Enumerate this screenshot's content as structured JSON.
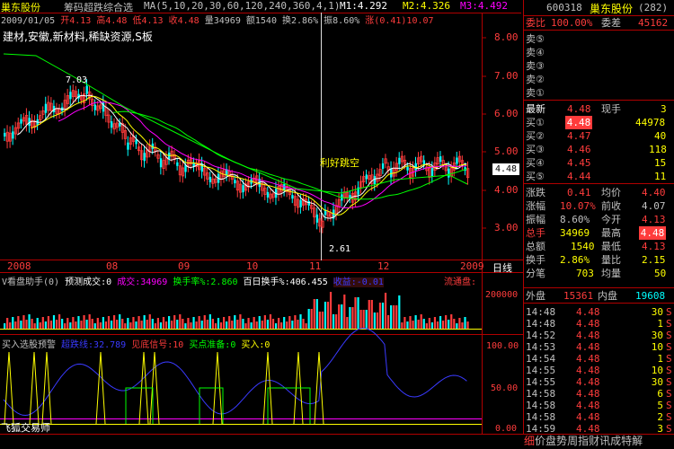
{
  "colors": {
    "up": "#ff3c3c",
    "down": "#00ffff",
    "flat": "#ffffff",
    "yellow": "#ffff00",
    "green": "#00ff00",
    "magenta": "#ff00ff",
    "blue": "#3a3aff",
    "axis": "#b00000"
  },
  "header": {
    "stock_name": "巢东股份",
    "indicator": "筹码超跌综合选",
    "ma_label": "MA(5,10,20,30,60,120,240,360,4,1)",
    "m1": "M1:4.292",
    "m2": "M2:4.326",
    "m3": "M3:4.492"
  },
  "info_line": {
    "date": "2009/01/05",
    "open_label": "开",
    "open": "4.13",
    "high_label": "高",
    "high": "4.48",
    "low_label": "低",
    "low": "4.13",
    "close_label": "收",
    "close": "4.48",
    "vol_label": "量",
    "vol": "34969",
    "amt_label": "额",
    "amt": "1540",
    "turnover_label": "换",
    "turnover": "2.86%",
    "amp_label": "振",
    "amp": "8.60%",
    "rise_label": "涨",
    "rise": "(0.41)10.07"
  },
  "sectors": "建材,安徽,新材料,稀缺资源,S板",
  "price_chart": {
    "y_ticks": [
      "8.00",
      "7.00",
      "6.00",
      "5.00",
      "4.00",
      "3.00"
    ],
    "max_label": "7.03",
    "min_label": "2.61",
    "event_label": "利好跳空",
    "current_price": "4.48"
  },
  "x_axis": {
    "labels": [
      "2008",
      "08",
      "09",
      "10",
      "11",
      "12",
      "2009"
    ],
    "period": "日线"
  },
  "volume_panel": {
    "title": "V看盘助手(0)",
    "deal_label": "预测成交:0",
    "vol_text": "成交:34969",
    "turn_text": "换手率%:2.860",
    "hundred_text": "百日换手%:406.455",
    "pan_text": "收益:-0.01",
    "circ_text": "流通盘:",
    "y_tick": "200000"
  },
  "signal_panel": {
    "title": "买入选股预警",
    "super": "超跌线:32.789",
    "signal": "见底信号:10",
    "ready": "买点准备:0",
    "buy": "买入:0",
    "y_ticks": [
      "100.00",
      "50.00",
      "0.00"
    ],
    "author": "飞狐交易师"
  },
  "quote": {
    "code": "600318",
    "name": "巢东股份",
    "count": "(282)",
    "wei_bi_label": "委比",
    "wei_bi": "100.00%",
    "wei_cha_label": "委差",
    "wei_cha": "45162",
    "sell": [
      {
        "label": "卖⑤",
        "p": "",
        "v": ""
      },
      {
        "label": "卖④",
        "p": "",
        "v": ""
      },
      {
        "label": "卖③",
        "p": "",
        "v": ""
      },
      {
        "label": "卖②",
        "p": "",
        "v": ""
      },
      {
        "label": "卖①",
        "p": "",
        "v": ""
      }
    ],
    "latest_label": "最新",
    "latest": "4.48",
    "now_hand_label": "现手",
    "now_hand": "3",
    "buy": [
      {
        "label": "买①",
        "p": "4.48",
        "v": "44978"
      },
      {
        "label": "买②",
        "p": "4.47",
        "v": "40"
      },
      {
        "label": "买③",
        "p": "4.46",
        "v": "118"
      },
      {
        "label": "买④",
        "p": "4.45",
        "v": "15"
      },
      {
        "label": "买⑤",
        "p": "4.44",
        "v": "11"
      }
    ],
    "stats": [
      {
        "l1": "涨跌",
        "v1": "0.41",
        "l2": "均价",
        "v2": "4.40"
      },
      {
        "l1": "涨幅",
        "v1": "10.07%",
        "l2": "前收",
        "v2": "4.07"
      },
      {
        "l1": "振幅",
        "v1": "8.60%",
        "l2": "今开",
        "v2": "4.13"
      },
      {
        "l1": "总手",
        "v1": "34969",
        "l2": "最高",
        "v2": "4.48"
      },
      {
        "l1": "总额",
        "v1": "1540",
        "l2": "最低",
        "v2": "4.13"
      },
      {
        "l1": "换手",
        "v1": "2.86%",
        "l2": "量比",
        "v2": "2.15"
      },
      {
        "l1": "分笔",
        "v1": "703",
        "l2": "均量",
        "v2": "50"
      }
    ],
    "outer_label": "外盘",
    "outer": "15361",
    "inner_label": "内盘",
    "inner": "19608",
    "ticks": [
      {
        "t": "14:48",
        "p": "4.48",
        "v": "30",
        "d": "S"
      },
      {
        "t": "14:48",
        "p": "4.48",
        "v": "1",
        "d": "S"
      },
      {
        "t": "14:52",
        "p": "4.48",
        "v": "30",
        "d": "S"
      },
      {
        "t": "14:53",
        "p": "4.48",
        "v": "10",
        "d": "S"
      },
      {
        "t": "14:54",
        "p": "4.48",
        "v": "1",
        "d": "S"
      },
      {
        "t": "14:55",
        "p": "4.48",
        "v": "10",
        "d": "S"
      },
      {
        "t": "14:55",
        "p": "4.48",
        "v": "30",
        "d": "S"
      },
      {
        "t": "14:58",
        "p": "4.48",
        "v": "6",
        "d": "S"
      },
      {
        "t": "14:58",
        "p": "4.48",
        "v": "5",
        "d": "S"
      },
      {
        "t": "14:58",
        "p": "4.48",
        "v": "2",
        "d": "S"
      },
      {
        "t": "14:59",
        "p": "4.48",
        "v": "3",
        "d": "S"
      }
    ],
    "bottom_tabs": [
      "细",
      "价",
      "盘",
      "势",
      "周",
      "指",
      "财",
      "讯",
      "成",
      "特",
      "解"
    ]
  }
}
